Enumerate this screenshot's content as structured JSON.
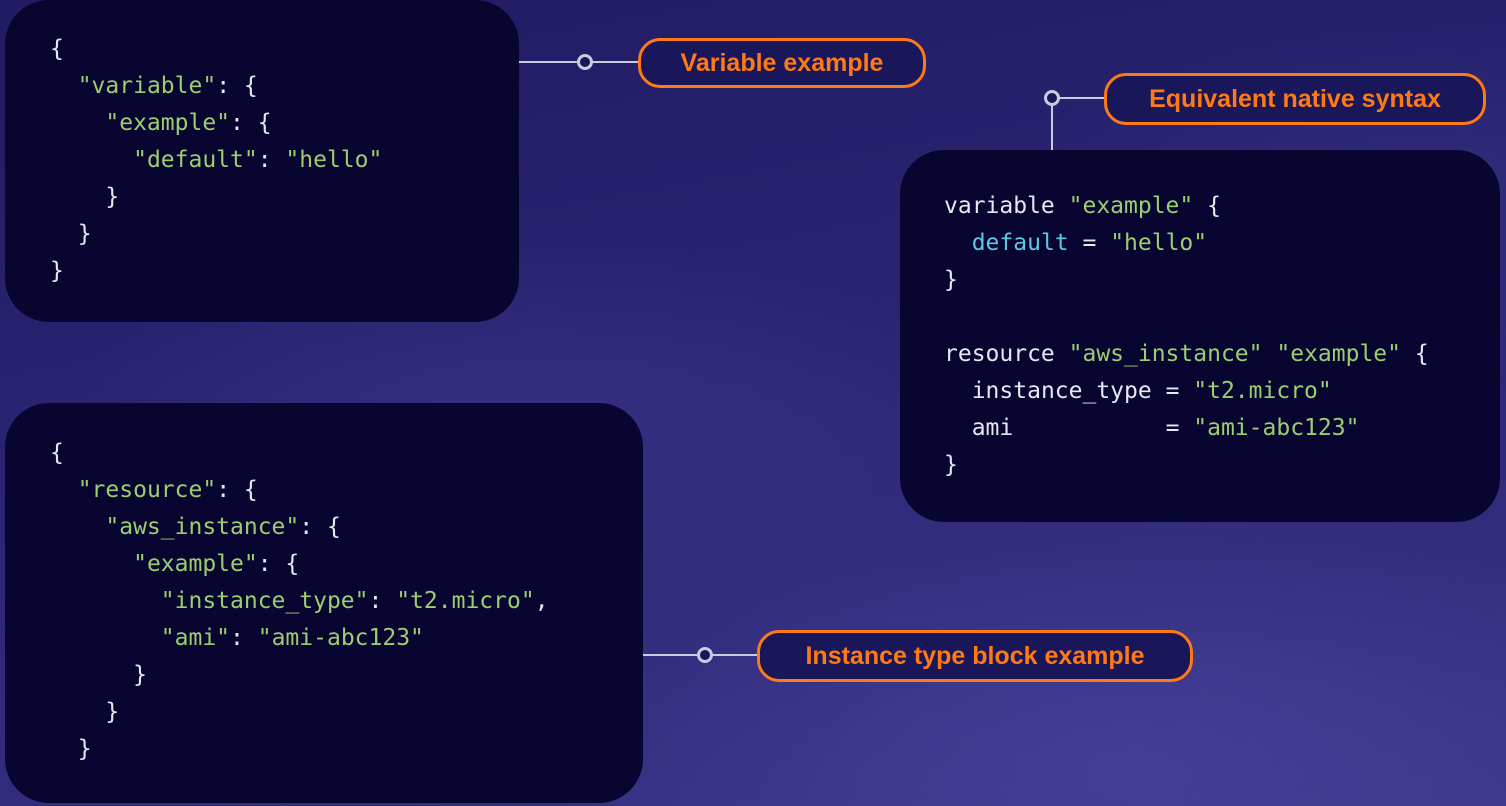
{
  "labels": {
    "variable_example": "Variable example",
    "equivalent_native_syntax": "Equivalent native syntax",
    "instance_type_block_example": "Instance type block example"
  },
  "variable_json": {
    "l1_open": "{",
    "l2_key": "\"variable\"",
    "l2_rest": ": {",
    "l3_key": "\"example\"",
    "l3_rest": ": {",
    "l4_key": "\"default\"",
    "l4_sep": ": ",
    "l4_val": "\"hello\"",
    "l5_close": "}",
    "l6_close": "}",
    "l7_close": "}"
  },
  "native": {
    "l1_kw": "variable ",
    "l1_name": "\"example\"",
    "l1_rest": " {",
    "l2_attr": "default",
    "l2_eq": " = ",
    "l2_val": "\"hello\"",
    "l3_close": "}",
    "l5_kw": "resource ",
    "l5_type": "\"aws_instance\"",
    "l5_sp": " ",
    "l5_name": "\"example\"",
    "l5_rest": " {",
    "l6_attr": "instance_type",
    "l6_eq": " = ",
    "l6_val": "\"t2.micro\"",
    "l7_attr": "ami",
    "l7_eq": "           = ",
    "l7_val": "\"ami-abc123\"",
    "l8_close": "}"
  },
  "resource_json": {
    "l1_open": "{",
    "l2_key": "\"resource\"",
    "l2_rest": ": {",
    "l3_key": "\"aws_instance\"",
    "l3_rest": ": {",
    "l4_key": "\"example\"",
    "l4_rest": ": {",
    "l5_key": "\"instance_type\"",
    "l5_sep": ": ",
    "l5_val": "\"t2.micro\"",
    "l5_comma": ",",
    "l6_key": "\"ami\"",
    "l6_sep": ": ",
    "l6_val": "\"ami-abc123\"",
    "l7_close": "}",
    "l8_close": "}",
    "l9_close": "}"
  },
  "colors": {
    "accent_orange": "#ff7a14",
    "string_green": "#9ccd71",
    "attr_cyan": "#5bc8e6",
    "card_bg": "#080630"
  }
}
